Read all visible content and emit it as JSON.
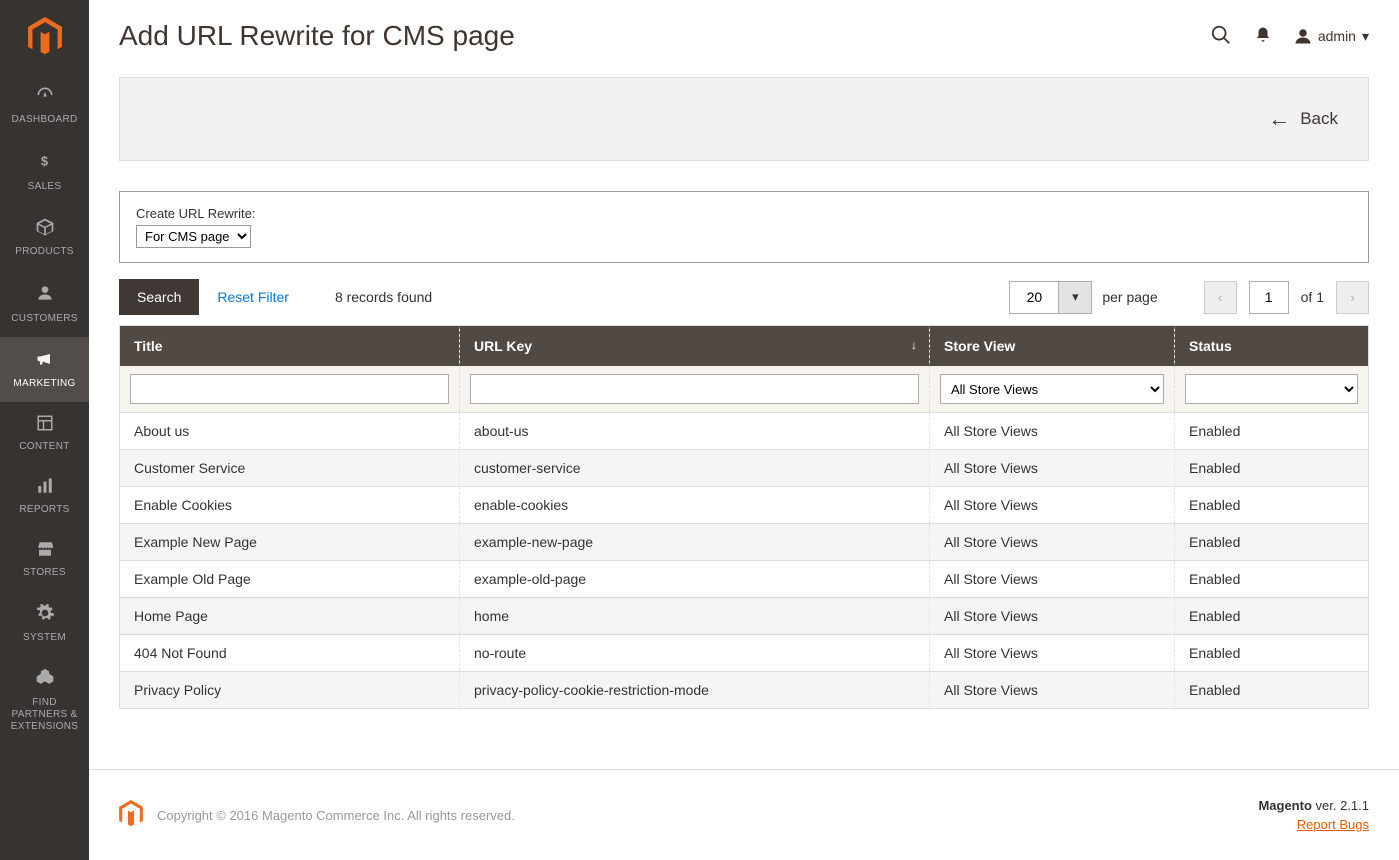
{
  "sidebar": {
    "items": [
      {
        "label": "DASHBOARD",
        "icon": "dashboard"
      },
      {
        "label": "SALES",
        "icon": "dollar"
      },
      {
        "label": "PRODUCTS",
        "icon": "box"
      },
      {
        "label": "CUSTOMERS",
        "icon": "person"
      },
      {
        "label": "MARKETING",
        "icon": "megaphone",
        "active": true
      },
      {
        "label": "CONTENT",
        "icon": "layout"
      },
      {
        "label": "REPORTS",
        "icon": "bars"
      },
      {
        "label": "STORES",
        "icon": "storefront"
      },
      {
        "label": "SYSTEM",
        "icon": "gear"
      },
      {
        "label": "FIND PARTNERS & EXTENSIONS",
        "icon": "cubes"
      }
    ]
  },
  "header": {
    "title": "Add URL Rewrite for CMS page",
    "user": "admin"
  },
  "back_bar": {
    "label": "Back"
  },
  "rewrite_box": {
    "label": "Create URL Rewrite:",
    "selected": "For CMS page"
  },
  "toolbar": {
    "search_label": "Search",
    "reset_label": "Reset Filter",
    "records_found": "8 records found",
    "per_page_value": "20",
    "per_page_label": "per page",
    "page_current": "1",
    "page_total_label": "of 1"
  },
  "table": {
    "columns": [
      "Title",
      "URL Key",
      "Store View",
      "Status"
    ],
    "store_view_filter_selected": "All Store Views",
    "rows": [
      {
        "title": "About us",
        "url_key": "about-us",
        "store_view": "All Store Views",
        "status": "Enabled"
      },
      {
        "title": "Customer Service",
        "url_key": "customer-service",
        "store_view": "All Store Views",
        "status": "Enabled"
      },
      {
        "title": "Enable Cookies",
        "url_key": "enable-cookies",
        "store_view": "All Store Views",
        "status": "Enabled"
      },
      {
        "title": "Example New Page",
        "url_key": "example-new-page",
        "store_view": "All Store Views",
        "status": "Enabled"
      },
      {
        "title": "Example Old Page",
        "url_key": "example-old-page",
        "store_view": "All Store Views",
        "status": "Enabled"
      },
      {
        "title": "Home Page",
        "url_key": "home",
        "store_view": "All Store Views",
        "status": "Enabled"
      },
      {
        "title": "404 Not Found",
        "url_key": "no-route",
        "store_view": "All Store Views",
        "status": "Enabled"
      },
      {
        "title": "Privacy Policy",
        "url_key": "privacy-policy-cookie-restriction-mode",
        "store_view": "All Store Views",
        "status": "Enabled"
      }
    ]
  },
  "footer": {
    "copyright": "Copyright © 2016 Magento Commerce Inc. All rights reserved.",
    "product": "Magento",
    "version": " ver. 2.1.1",
    "bugs": "Report Bugs"
  }
}
